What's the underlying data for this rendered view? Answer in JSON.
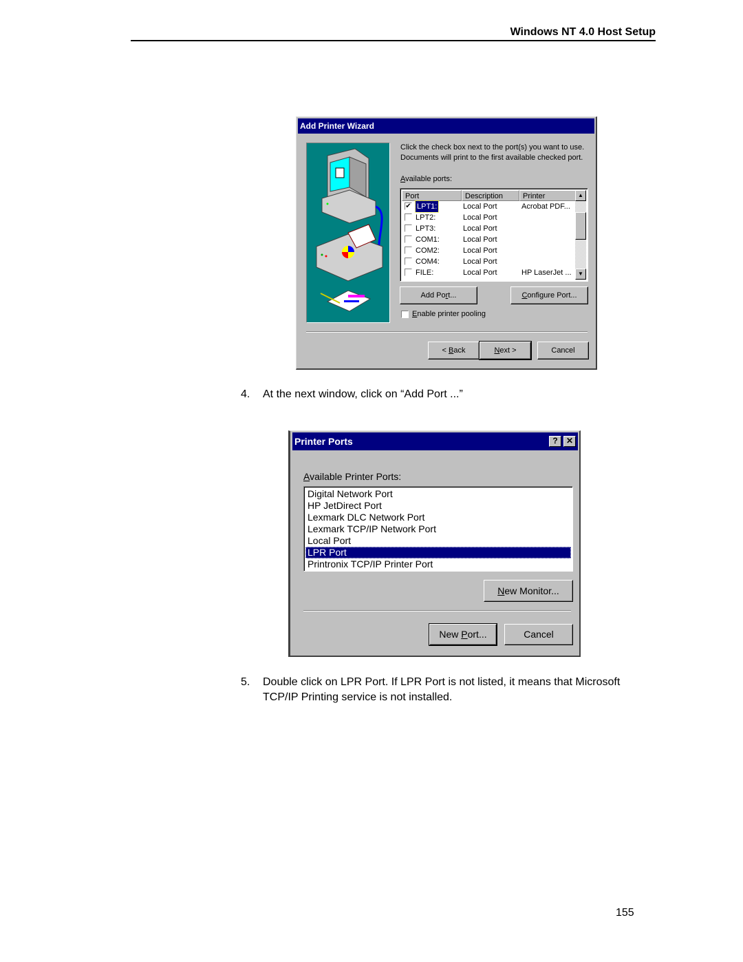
{
  "page": {
    "header_title": "Windows NT 4.0 Host Setup",
    "page_number": "155",
    "steps": [
      {
        "number": "4.",
        "text": "At the next window, click on “Add Port ...”"
      },
      {
        "number": "5.",
        "text_line1": "Double click on LPR Port. If LPR Port is not listed, it means that Microsoft",
        "text_line2": "TCP/IP Printing service is not installed."
      }
    ]
  },
  "wizard": {
    "title": "Add Printer Wizard",
    "instruction_line1": "Click the check box next to the port(s) you want to use.",
    "instruction_line2": "Documents will print to the first available checked port.",
    "ports_label_accel": "A",
    "ports_label_rest": "vailable ports:",
    "columns": [
      "Port",
      "Description",
      "Printer"
    ],
    "ports": [
      {
        "port": "LPT1:",
        "description": "Local Port",
        "printer": "Acrobat PDF...",
        "checked": "✔",
        "selected": true
      },
      {
        "port": "LPT2:",
        "description": "Local Port",
        "printer": "",
        "checked": ""
      },
      {
        "port": "LPT3:",
        "description": "Local Port",
        "printer": "",
        "checked": ""
      },
      {
        "port": "COM1:",
        "description": "Local Port",
        "printer": "",
        "checked": ""
      },
      {
        "port": "COM2:",
        "description": "Local Port",
        "printer": "",
        "checked": ""
      },
      {
        "port": "COM4:",
        "description": "Local Port",
        "printer": "",
        "checked": ""
      },
      {
        "port": "FILE:",
        "description": "Local Port",
        "printer": "HP LaserJet ...",
        "checked": ""
      }
    ],
    "scroll_up": "▲",
    "scroll_down": "▼",
    "add_port_a": "Add Po",
    "add_port_u": "r",
    "add_port_b": "t...",
    "configure_u": "C",
    "configure_rest": "onfigure Port...",
    "pooling_u": "E",
    "pooling_rest": "nable printer pooling",
    "back_a": "< ",
    "back_u": "B",
    "back_b": "ack",
    "next_u": "N",
    "next_rest": "ext >",
    "cancel": "Cancel",
    "accent_color": "#000080",
    "illustration_bg": "#008080"
  },
  "printer_ports": {
    "title": "Printer Ports",
    "help_button": "?",
    "close_button": "✕",
    "label_u": "A",
    "label_rest": "vailable Printer Ports:",
    "items": [
      "Digital Network Port",
      "HP JetDirect Port",
      "Lexmark DLC Network Port",
      "Lexmark TCP/IP Network Port",
      "Local Port",
      "LPR Port",
      "Printronix TCP/IP Printer Port"
    ],
    "selected_item": "LPR Port",
    "new_monitor_u": "N",
    "new_monitor_rest": "ew Monitor...",
    "new_port_a": "New ",
    "new_port_u": "P",
    "new_port_b": "ort...",
    "cancel": "Cancel"
  }
}
